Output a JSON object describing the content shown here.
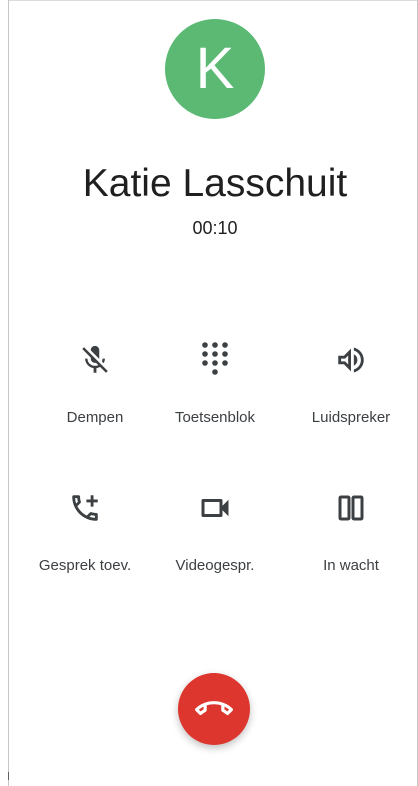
{
  "caller": {
    "initial": "K",
    "name": "Katie Lasschuit",
    "duration": "00:10",
    "avatar_color": "#5bb974"
  },
  "actions": [
    {
      "id": "mute",
      "label": "Dempen",
      "icon": "mic-off-icon"
    },
    {
      "id": "keypad",
      "label": "Toetsenblok",
      "icon": "dialpad-icon"
    },
    {
      "id": "speaker",
      "label": "Luidspreker",
      "icon": "volume-icon"
    },
    {
      "id": "add-call",
      "label": "Gesprek toev.",
      "icon": "add-call-icon"
    },
    {
      "id": "video",
      "label": "Videogespr.",
      "icon": "videocam-icon"
    },
    {
      "id": "hold",
      "label": "In wacht",
      "icon": "pause-icon"
    }
  ],
  "end_call": {
    "icon": "call-end-icon",
    "color": "#dc362e"
  }
}
